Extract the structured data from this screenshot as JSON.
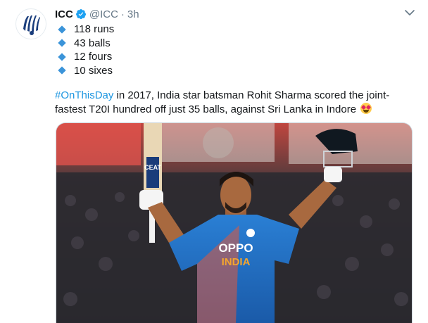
{
  "account": {
    "name": "ICC",
    "handle": "@ICC",
    "separator": "·",
    "time": "3h",
    "avatar_icon": "icc-logo-icon",
    "verified_icon": "verified-badge-icon"
  },
  "stats": [
    {
      "text": "118 runs"
    },
    {
      "text": "43 balls"
    },
    {
      "text": "12 fours"
    },
    {
      "text": "10 sixes"
    }
  ],
  "body": {
    "hashtag": "#OnThisDay",
    "text": " in 2017, India star batsman Rohit Sharma scored the joint-fastest T20I hundred off just 35 balls, against Sri Lanka in Indore ",
    "emoji_icon": "star-struck-emoji-icon"
  },
  "media": {
    "bat_sticker": "CEAT",
    "jersey_sponsor": "OPPO",
    "jersey_team": "INDIA"
  },
  "colors": {
    "link": "#1b95e0",
    "bullet": "#3b94d9",
    "jersey": "#1f6fc1",
    "secondary_text": "#657786"
  }
}
